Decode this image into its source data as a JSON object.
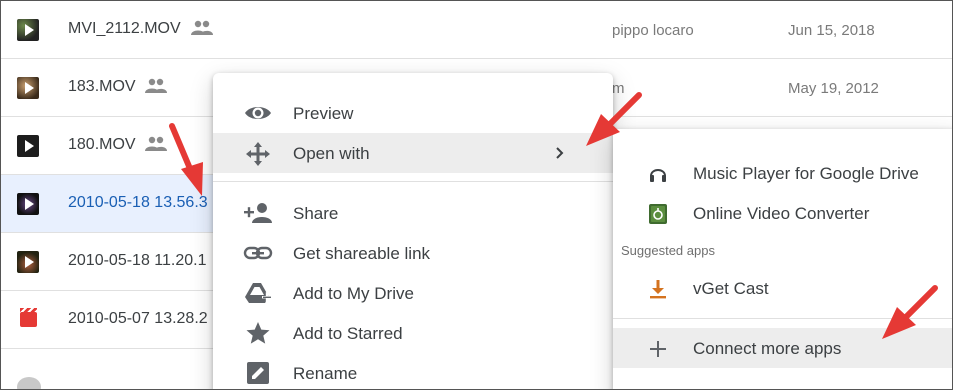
{
  "files": [
    {
      "name": "MVI_2112.MOV",
      "owner": "pippo locaro",
      "date": "Jun 15, 2018",
      "thumb": "video-thumbnail-icon"
    },
    {
      "name": "183.MOV",
      "owner": "m",
      "date": "May 19, 2012",
      "thumb": "video-thumbnail-icon"
    },
    {
      "name": "180.MOV",
      "owner": "",
      "date": "",
      "thumb": "video-thumbnail-icon"
    },
    {
      "name": "2010-05-18 13.56.3",
      "owner": "",
      "date": "",
      "thumb": "video-thumbnail-icon",
      "selected": true
    },
    {
      "name": "2010-05-18 11.20.1",
      "owner": "",
      "date": "",
      "thumb": "video-thumbnail-icon"
    },
    {
      "name": "2010-05-07 13.28.2",
      "owner": "",
      "date": "",
      "thumb": "clapperboard-icon"
    }
  ],
  "context_menu": {
    "items": [
      {
        "label": "Preview",
        "icon": "eye-icon"
      },
      {
        "label": "Open with",
        "icon": "move-arrows-icon",
        "has_submenu": true,
        "highlighted": true
      },
      {
        "label": "Share",
        "icon": "add-person-icon"
      },
      {
        "label": "Get shareable link",
        "icon": "link-icon"
      },
      {
        "label": "Add to My Drive",
        "icon": "drive-add-icon"
      },
      {
        "label": "Add to Starred",
        "icon": "star-icon"
      },
      {
        "label": "Rename",
        "icon": "pencil-icon"
      }
    ]
  },
  "open_with_menu": {
    "apps": [
      {
        "label": "Music Player for Google Drive",
        "icon": "headphones-icon"
      },
      {
        "label": "Online Video Converter",
        "icon": "video-converter-icon"
      }
    ],
    "suggested_heading": "Suggested apps",
    "suggested": [
      {
        "label": "vGet Cast",
        "icon": "download-icon"
      }
    ],
    "connect_more": {
      "label": "Connect more apps",
      "icon": "plus-icon",
      "highlighted": true
    }
  },
  "colors": {
    "selected_row_bg": "#e8f0fe",
    "selected_text": "#1a5fb4",
    "annotation_arrow": "#e53935",
    "menu_hover_bg": "#ededed"
  }
}
